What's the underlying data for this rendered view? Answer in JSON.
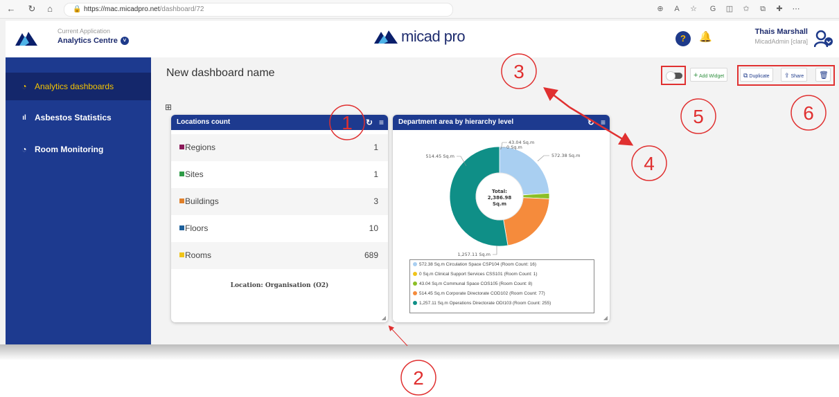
{
  "browser": {
    "url_host": "https://mac.micadpro.net",
    "url_path": "/dashboard/72"
  },
  "header": {
    "app_label": "Current Application",
    "app_name": "Analytics Centre",
    "brand": "micad pro",
    "user_name": "Thais Marshall",
    "user_role": "MicadAdmin [clara]"
  },
  "sidebar": {
    "items": [
      {
        "label": "Analytics dashboards",
        "icon": "pie-chart-icon",
        "active": true
      },
      {
        "label": "Asbestos Statistics",
        "icon": "bar-chart-icon",
        "active": false
      },
      {
        "label": "Room Monitoring",
        "icon": "pie-chart-icon",
        "active": false
      }
    ]
  },
  "dashboard": {
    "title": "New dashboard name",
    "toolbar": {
      "add_widget": "Add Widget",
      "duplicate": "Duplicate",
      "share": "Share"
    }
  },
  "locations_widget": {
    "title": "Locations count",
    "rows": [
      {
        "label": "Regions",
        "value": "1",
        "color": "#8b1a5a"
      },
      {
        "label": "Sites",
        "value": "1",
        "color": "#2e9b47"
      },
      {
        "label": "Buildings",
        "value": "3",
        "color": "#e0802a"
      },
      {
        "label": "Floors",
        "value": "10",
        "color": "#1d5f9a"
      },
      {
        "label": "Rooms",
        "value": "689",
        "color": "#f0c419"
      }
    ],
    "footer": "Location: Organisation (O2)"
  },
  "department_widget": {
    "title": "Department area by hierarchy level",
    "total_label": "Total:",
    "total_value": "2,386.98",
    "total_unit": "Sq.m",
    "slice_labels": [
      "572.38 Sq.m",
      "0 Sq.m",
      "43.04 Sq.m",
      "514.45 Sq.m",
      "1,257.11 Sq.m"
    ],
    "legend": [
      {
        "text": "572.38 Sq.m Circulation Space CSP104 (Room Count: 16)",
        "color": "#a9cff1"
      },
      {
        "text": "0 Sq.m Clinical Support Services CSS101 (Room Count: 1)",
        "color": "#f0c419"
      },
      {
        "text": "43.04 Sq.m Communal Space COS105 (Room Count: 8)",
        "color": "#8cbf26"
      },
      {
        "text": "514.45 Sq.m Corporate Directorate COD102 (Room Count: 77)",
        "color": "#f58b3c"
      },
      {
        "text": "1,257.11 Sq.m Operations Directorate ODI103 (Room Count: 255)",
        "color": "#0f8f87"
      }
    ]
  },
  "chart_data": {
    "type": "pie",
    "title": "Department area by hierarchy level",
    "categories": [
      "Circulation Space CSP104",
      "Clinical Support Services CSS101",
      "Communal Space COS105",
      "Corporate Directorate COD102",
      "Operations Directorate ODI103"
    ],
    "values": [
      572.38,
      0,
      43.04,
      514.45,
      1257.11
    ],
    "colors": [
      "#a9cff1",
      "#f0c419",
      "#8cbf26",
      "#f58b3c",
      "#0f8f87"
    ],
    "unit": "Sq.m",
    "legend": "bottom"
  },
  "annotations": [
    "1",
    "2",
    "3",
    "4",
    "5",
    "6"
  ]
}
